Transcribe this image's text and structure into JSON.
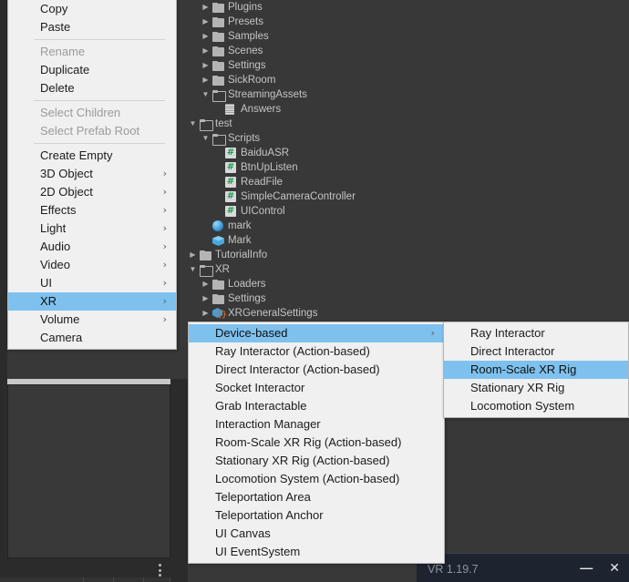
{
  "app": {
    "background_color": "#383838",
    "menu_bg": "#f0f0f0",
    "highlight_color": "#7fc1ee"
  },
  "project_tree": {
    "rows": [
      {
        "label": "Plugins",
        "icon": "folder-icon",
        "indent": 1,
        "twisty": "right",
        "type": "folder"
      },
      {
        "label": "Presets",
        "icon": "folder-icon",
        "indent": 1,
        "twisty": "right",
        "type": "folder"
      },
      {
        "label": "Samples",
        "icon": "folder-icon",
        "indent": 1,
        "twisty": "right",
        "type": "folder"
      },
      {
        "label": "Scenes",
        "icon": "folder-icon",
        "indent": 1,
        "twisty": "right",
        "type": "folder"
      },
      {
        "label": "Settings",
        "icon": "folder-icon",
        "indent": 1,
        "twisty": "right",
        "type": "folder"
      },
      {
        "label": "SickRoom",
        "icon": "folder-icon",
        "indent": 1,
        "twisty": "right",
        "type": "folder"
      },
      {
        "label": "StreamingAssets",
        "icon": "folder-open-icon",
        "indent": 1,
        "twisty": "down",
        "type": "folder-open"
      },
      {
        "label": "Answers",
        "icon": "text-file-icon",
        "indent": 2,
        "twisty": "none",
        "type": "file"
      },
      {
        "label": "test",
        "icon": "folder-open-icon",
        "indent": 0,
        "twisty": "down",
        "type": "folder-open"
      },
      {
        "label": "Scripts",
        "icon": "folder-open-icon",
        "indent": 1,
        "twisty": "down",
        "type": "folder-open"
      },
      {
        "label": "BaiduASR",
        "icon": "csharp-script-icon",
        "indent": 2,
        "twisty": "none",
        "type": "script"
      },
      {
        "label": "BtnUpListen",
        "icon": "csharp-script-icon",
        "indent": 2,
        "twisty": "none",
        "type": "script"
      },
      {
        "label": "ReadFile",
        "icon": "csharp-script-icon",
        "indent": 2,
        "twisty": "none",
        "type": "script"
      },
      {
        "label": "SimpleCameraController",
        "icon": "csharp-script-icon",
        "indent": 2,
        "twisty": "none",
        "type": "script"
      },
      {
        "label": "UIControl",
        "icon": "csharp-script-icon",
        "indent": 2,
        "twisty": "none",
        "type": "script"
      },
      {
        "label": "mark",
        "icon": "material-sphere-icon",
        "indent": 1,
        "twisty": "none",
        "type": "material"
      },
      {
        "label": "Mark",
        "icon": "prefab-cube-icon",
        "indent": 1,
        "twisty": "none",
        "type": "prefab"
      },
      {
        "label": "TutorialInfo",
        "icon": "folder-icon",
        "indent": 0,
        "twisty": "right",
        "type": "folder"
      },
      {
        "label": "XR",
        "icon": "folder-open-icon",
        "indent": 0,
        "twisty": "down",
        "type": "folder-open"
      },
      {
        "label": "Loaders",
        "icon": "folder-icon",
        "indent": 1,
        "twisty": "right",
        "type": "folder"
      },
      {
        "label": "Settings",
        "icon": "folder-icon",
        "indent": 1,
        "twisty": "right",
        "type": "folder"
      },
      {
        "label": "XRGeneralSettings",
        "icon": "xr-settings-asset-icon",
        "indent": 1,
        "twisty": "right",
        "type": "asset"
      }
    ]
  },
  "context_menu": {
    "items": [
      {
        "label": "Copy",
        "state": "normal",
        "submenu": false
      },
      {
        "label": "Paste",
        "state": "normal",
        "submenu": false
      },
      {
        "label": "",
        "state": "separator",
        "submenu": false
      },
      {
        "label": "Rename",
        "state": "disabled",
        "submenu": false
      },
      {
        "label": "Duplicate",
        "state": "normal",
        "submenu": false
      },
      {
        "label": "Delete",
        "state": "normal",
        "submenu": false
      },
      {
        "label": "",
        "state": "separator",
        "submenu": false
      },
      {
        "label": "Select Children",
        "state": "disabled",
        "submenu": false
      },
      {
        "label": "Select Prefab Root",
        "state": "disabled",
        "submenu": false
      },
      {
        "label": "",
        "state": "separator",
        "submenu": false
      },
      {
        "label": "Create Empty",
        "state": "normal",
        "submenu": false
      },
      {
        "label": "3D Object",
        "state": "normal",
        "submenu": true
      },
      {
        "label": "2D Object",
        "state": "normal",
        "submenu": true
      },
      {
        "label": "Effects",
        "state": "normal",
        "submenu": true
      },
      {
        "label": "Light",
        "state": "normal",
        "submenu": true
      },
      {
        "label": "Audio",
        "state": "normal",
        "submenu": true
      },
      {
        "label": "Video",
        "state": "normal",
        "submenu": true
      },
      {
        "label": "UI",
        "state": "normal",
        "submenu": true
      },
      {
        "label": "XR",
        "state": "selected",
        "submenu": true
      },
      {
        "label": "Volume",
        "state": "normal",
        "submenu": true
      },
      {
        "label": "Camera",
        "state": "normal",
        "submenu": false
      }
    ]
  },
  "xr_submenu": {
    "items": [
      {
        "label": "Device-based",
        "state": "selected",
        "submenu": true
      },
      {
        "label": "Ray Interactor (Action-based)",
        "state": "normal",
        "submenu": false
      },
      {
        "label": "Direct Interactor (Action-based)",
        "state": "normal",
        "submenu": false
      },
      {
        "label": "Socket Interactor",
        "state": "normal",
        "submenu": false
      },
      {
        "label": "Grab Interactable",
        "state": "normal",
        "submenu": false
      },
      {
        "label": "Interaction Manager",
        "state": "normal",
        "submenu": false
      },
      {
        "label": "Room-Scale XR Rig (Action-based)",
        "state": "normal",
        "submenu": false
      },
      {
        "label": "Stationary XR Rig (Action-based)",
        "state": "normal",
        "submenu": false
      },
      {
        "label": "Locomotion System (Action-based)",
        "state": "normal",
        "submenu": false
      },
      {
        "label": "Teleportation Area",
        "state": "normal",
        "submenu": false
      },
      {
        "label": "Teleportation Anchor",
        "state": "normal",
        "submenu": false
      },
      {
        "label": "UI Canvas",
        "state": "normal",
        "submenu": false
      },
      {
        "label": "UI EventSystem",
        "state": "normal",
        "submenu": false
      }
    ]
  },
  "device_based_submenu": {
    "items": [
      {
        "label": "Ray Interactor",
        "state": "normal",
        "submenu": false
      },
      {
        "label": "Direct Interactor",
        "state": "normal",
        "submenu": false
      },
      {
        "label": "Room-Scale XR Rig",
        "state": "selected",
        "submenu": false
      },
      {
        "label": "Stationary XR Rig",
        "state": "normal",
        "submenu": false
      },
      {
        "label": "Locomotion System",
        "state": "normal",
        "submenu": false
      }
    ]
  },
  "vr_window": {
    "title": "VR 1.19.7",
    "minimize_label": "—",
    "close_label": "✕"
  },
  "icons": {
    "submenu_arrow": "›",
    "twisty_right": "▶",
    "twisty_down": "▼",
    "kebab": "more-options-icon"
  }
}
